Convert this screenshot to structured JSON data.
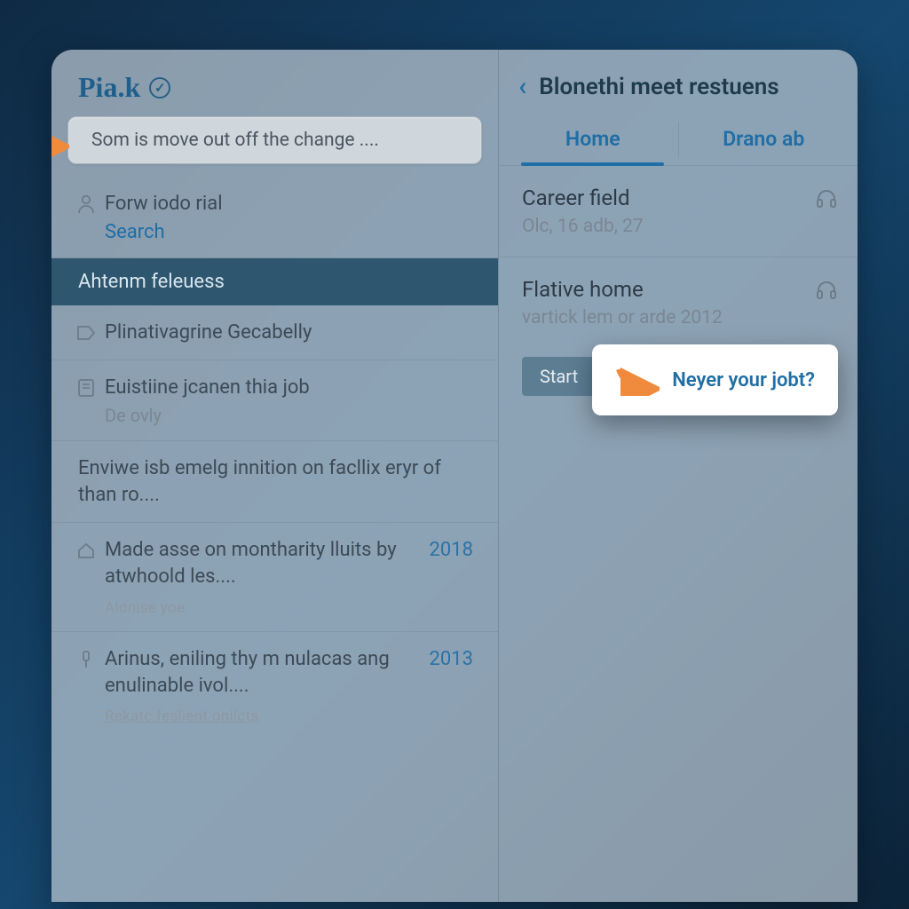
{
  "brand": "Pia.k",
  "search": {
    "text": "Som is move out off the change ...."
  },
  "left_block_a": {
    "title": "Forw iodo rial",
    "link": "Search"
  },
  "section_header": "Ahtenm feleuess",
  "items": [
    {
      "title": "Plinativagrine Gecabelly"
    },
    {
      "title": "Euistiine jcanen thia job",
      "sub": "De ovly"
    },
    {
      "title": "Enviwe isb emelg innition on facllix eryr of than ro...."
    },
    {
      "title": "Made asse on montharity lluits by atwhoold les....",
      "year": "2018",
      "foot": "Aldnise yoe."
    },
    {
      "title": "Arinus, eniling thy m nulacas ang enulinable ivol....",
      "year": "2013",
      "foot": "Rekatc feslient onilcts"
    }
  ],
  "detail": {
    "title": "Blonethi meet restuens",
    "tabs": {
      "a": "Home",
      "b": "Drano ab"
    },
    "rows": [
      {
        "title": "Career field",
        "sub": "Olc, 16 adb, 27"
      },
      {
        "title": "Flative home",
        "sub": "vartick lem or arde 2012"
      }
    ],
    "start_label": "Start",
    "popover": "Neyer your jobt?"
  },
  "colors": {
    "accent": "#1f6ea5",
    "callout": "#f08a3c"
  }
}
